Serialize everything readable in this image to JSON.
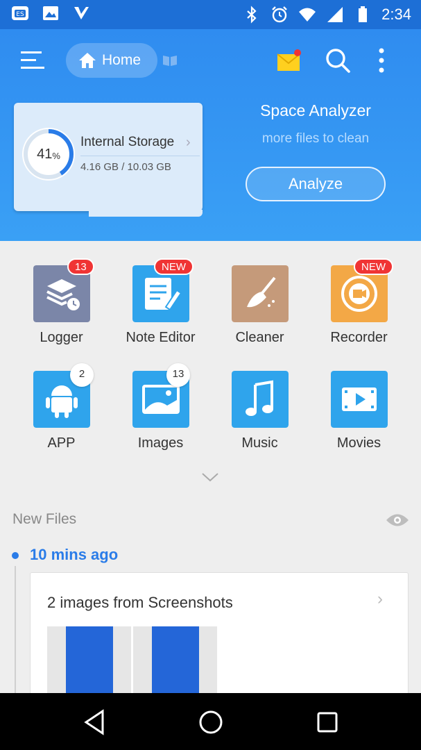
{
  "status_bar": {
    "time": "2:34",
    "icons": [
      "es-app-icon",
      "gallery-icon",
      "task-icon",
      "bluetooth-icon",
      "alarm-icon",
      "wifi-icon",
      "signal-icon",
      "battery-icon"
    ]
  },
  "header": {
    "home_label": "Home",
    "storage": {
      "percent": "41",
      "percent_unit": "%",
      "percent_value": 0.41,
      "title": "Internal Storage",
      "size": "4.16 GB / 10.03 GB"
    },
    "space_analyzer": {
      "title": "Space Analyzer",
      "subtitle": "more files to clean",
      "button": "Analyze"
    }
  },
  "tools": [
    {
      "label": "Logger",
      "badge": "13",
      "badge_style": "red",
      "icon": "logger-icon",
      "color": "#7b86a8"
    },
    {
      "label": "Note Editor",
      "badge": "NEW",
      "badge_style": "red",
      "icon": "note-editor-icon",
      "color": "#2fa4ec"
    },
    {
      "label": "Cleaner",
      "badge": "",
      "badge_style": "",
      "icon": "broom-icon",
      "color": "#c59a7a"
    },
    {
      "label": "Recorder",
      "badge": "NEW",
      "badge_style": "red",
      "icon": "recorder-icon",
      "color": "#f3a846"
    },
    {
      "label": "APP",
      "badge": "2",
      "badge_style": "white",
      "icon": "android-icon",
      "color": "#2fa4ec"
    },
    {
      "label": "Images",
      "badge": "13",
      "badge_style": "white",
      "icon": "image-icon",
      "color": "#2fa4ec"
    },
    {
      "label": "Music",
      "badge": "",
      "badge_style": "",
      "icon": "music-note-icon",
      "color": "#2fa4ec"
    },
    {
      "label": "Movies",
      "badge": "",
      "badge_style": "",
      "icon": "movie-icon",
      "color": "#2fa4ec"
    }
  ],
  "new_files": {
    "title": "New Files",
    "group_time": "10 mins ago",
    "card_title": "2 images from Screenshots"
  },
  "colors": {
    "accent": "#2a7ce8",
    "header_top": "#2f8cf0",
    "header_bottom": "#3aa0f5",
    "badge_red": "#f03434"
  }
}
